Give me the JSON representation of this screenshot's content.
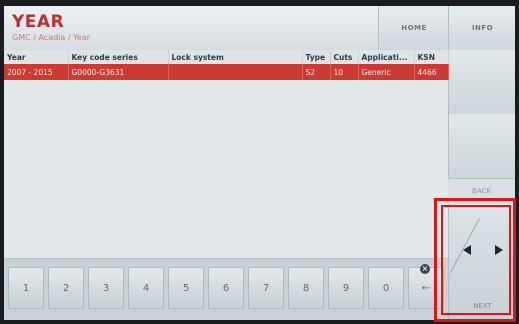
{
  "header": {
    "title": "YEAR",
    "breadcrumb": "GMC / Acadia / Year",
    "home_label": "HOME",
    "info_label": "INFO"
  },
  "table": {
    "columns": [
      "Year",
      "Key code series",
      "Lock system",
      "Type",
      "Cuts",
      "Applicati...",
      "KSN"
    ],
    "rows": [
      [
        "2007 - 2015",
        "G0000-G3631",
        "",
        "S2",
        "10",
        "Generic",
        "4466"
      ]
    ]
  },
  "side": {
    "back_label": "BACK",
    "next_label": "NEXT",
    "prev_icon": "triangle-left-icon",
    "next_icon": "triangle-right-icon"
  },
  "keypad": {
    "keys": [
      "1",
      "2",
      "3",
      "4",
      "5",
      "6",
      "7",
      "8",
      "9",
      "0",
      "←"
    ],
    "clear_icon": "close-circle-icon",
    "clear_glyph": "×"
  },
  "colors": {
    "accent": "#cc3a34",
    "title": "#b8312f",
    "highlight": "#e01414"
  }
}
